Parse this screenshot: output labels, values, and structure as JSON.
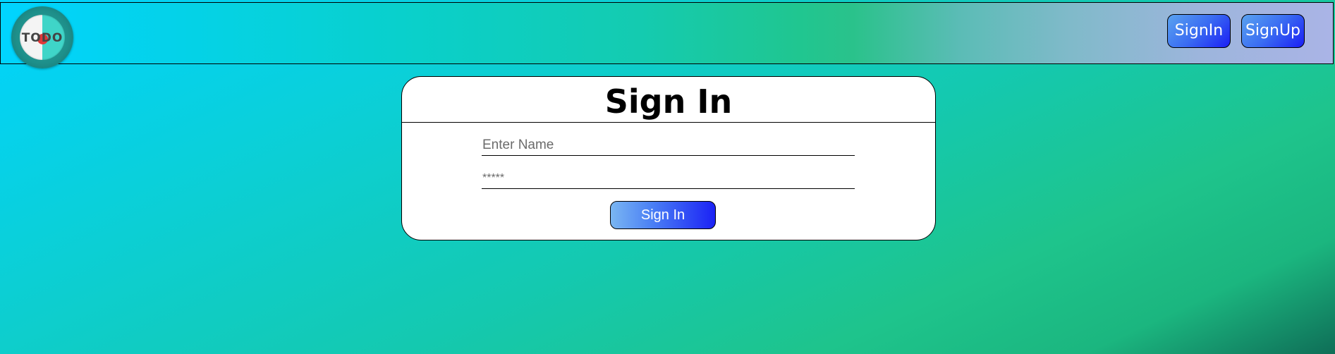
{
  "navbar": {
    "logo_text": "TODO",
    "signin_label": "SignIn",
    "signup_label": "SignUp"
  },
  "form": {
    "title": "Sign In",
    "name_placeholder": "Enter Name",
    "password_placeholder": "*****",
    "submit_label": "Sign In"
  },
  "colors": {
    "button_gradient_start": "#5aa3f0",
    "button_gradient_end": "#1b1ef4",
    "page_gradient_start": "#00d4ff",
    "page_gradient_end": "#0f6e57"
  },
  "icons": {
    "logo": "todo-logo-icon"
  }
}
